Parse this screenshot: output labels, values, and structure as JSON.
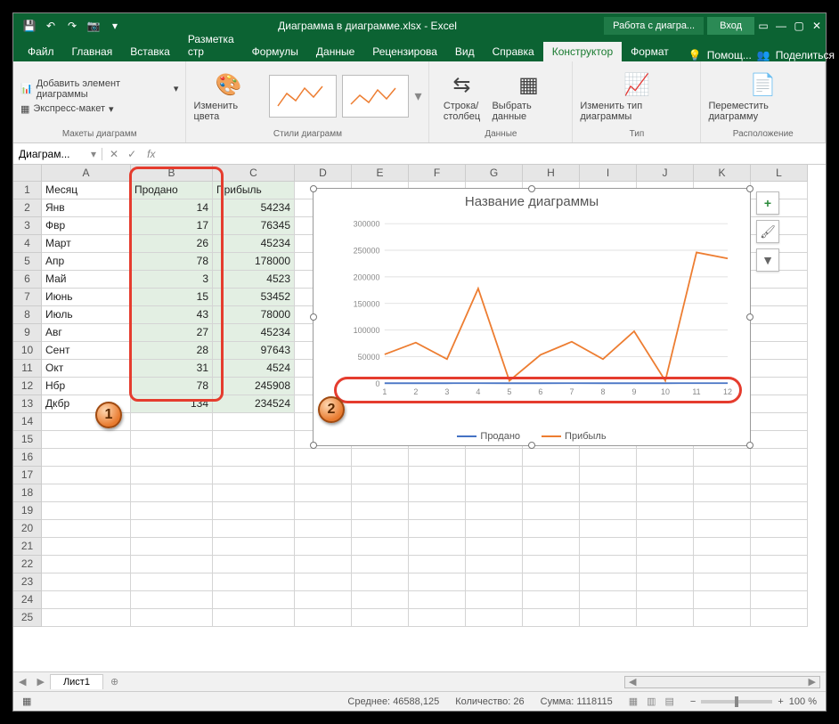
{
  "app": {
    "title": "Диаграмма в диаграмме.xlsx - Excel",
    "context_tab": "Работа с диагра...",
    "login": "Вход"
  },
  "tabs": {
    "file": "Файл",
    "home": "Главная",
    "insert": "Вставка",
    "layout": "Разметка стр",
    "formulas": "Формулы",
    "data": "Данные",
    "review": "Рецензирова",
    "view": "Вид",
    "help": "Справка",
    "design": "Конструктор",
    "format": "Формат",
    "tellme": "Помощ...",
    "share": "Поделиться"
  },
  "ribbon": {
    "add_element": "Добавить элемент диаграммы",
    "quick_layout": "Экспресс-макет",
    "layouts_group": "Макеты диаграмм",
    "change_colors": "Изменить цвета",
    "styles_group": "Стили диаграмм",
    "switch_rowcol": "Строка/\nстолбец",
    "select_data": "Выбрать данные",
    "data_group": "Данные",
    "change_type": "Изменить тип диаграммы",
    "type_group": "Тип",
    "move_chart": "Переместить диаграмму",
    "location_group": "Расположение"
  },
  "namebox": "Диаграм...",
  "columns": [
    "A",
    "B",
    "C",
    "D",
    "E",
    "F",
    "G",
    "H",
    "I",
    "J",
    "K",
    "L"
  ],
  "headers": {
    "A": "Месяц",
    "B": "Продано",
    "C": "Прибыль"
  },
  "rows": [
    {
      "m": "Янв",
      "s": 14,
      "p": 54234
    },
    {
      "m": "Фвр",
      "s": 17,
      "p": 76345
    },
    {
      "m": "Март",
      "s": 26,
      "p": 45234
    },
    {
      "m": "Апр",
      "s": 78,
      "p": 178000
    },
    {
      "m": "Май",
      "s": 3,
      "p": 4523
    },
    {
      "m": "Июнь",
      "s": 15,
      "p": 53452
    },
    {
      "m": "Июль",
      "s": 43,
      "p": 78000
    },
    {
      "m": "Авг",
      "s": 27,
      "p": 45234
    },
    {
      "m": "Сент",
      "s": 28,
      "p": 97643
    },
    {
      "m": "Окт",
      "s": 31,
      "p": 4524
    },
    {
      "m": "Нбр",
      "s": 78,
      "p": 245908
    },
    {
      "m": "Дкбр",
      "s": 134,
      "p": 234524
    }
  ],
  "chart_data": {
    "type": "line",
    "title": "Название диаграммы",
    "x": [
      1,
      2,
      3,
      4,
      5,
      6,
      7,
      8,
      9,
      10,
      11,
      12
    ],
    "ylim": [
      0,
      300000
    ],
    "yticks": [
      0,
      50000,
      100000,
      150000,
      200000,
      250000,
      300000
    ],
    "series": [
      {
        "name": "Продано",
        "color": "#4472c4",
        "values": [
          14,
          17,
          26,
          78,
          3,
          15,
          43,
          27,
          28,
          31,
          78,
          134
        ]
      },
      {
        "name": "Прибыль",
        "color": "#ed7d31",
        "values": [
          54234,
          76345,
          45234,
          178000,
          4523,
          53452,
          78000,
          45234,
          97643,
          4524,
          245908,
          234524
        ]
      }
    ]
  },
  "sheet_tab": "Лист1",
  "status": {
    "avg_label": "Среднее:",
    "avg": "46588,125",
    "count_label": "Количество:",
    "count": "26",
    "sum_label": "Сумма:",
    "sum": "1118115",
    "zoom": "100 %"
  }
}
